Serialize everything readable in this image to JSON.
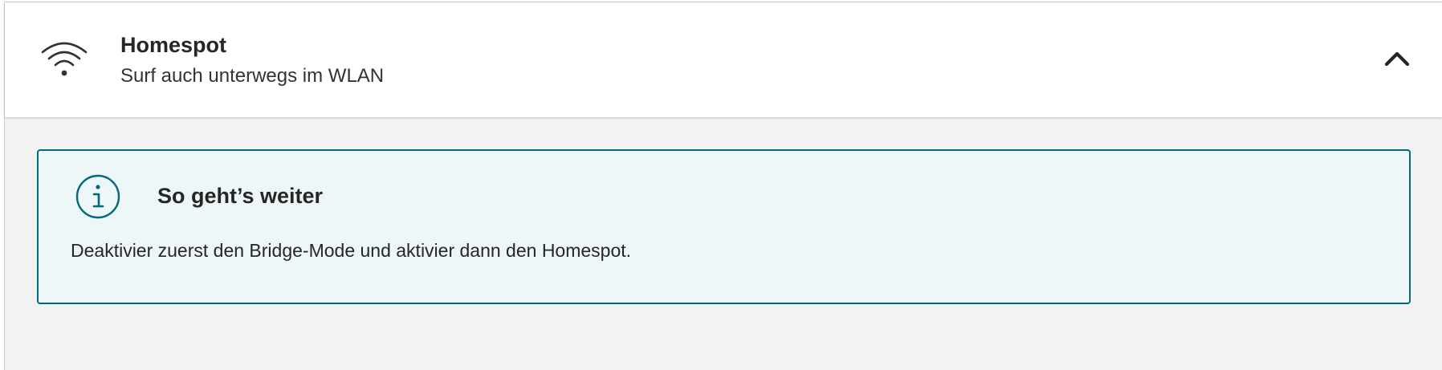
{
  "section": {
    "title": "Homespot",
    "subtitle": "Surf auch unterwegs im WLAN",
    "icon": "wifi-icon",
    "toggle_icon": "chevron-up-icon",
    "expanded": true
  },
  "notice": {
    "icon": "info-icon",
    "title": "So geht’s weiter",
    "message": "Deaktivier zuerst den Bridge-Mode und aktivier dann den Homespot."
  },
  "colors": {
    "accent": "#00697c",
    "notice_background": "#eef7f8",
    "panel_background": "#f2f2f2",
    "text": "#262626"
  }
}
